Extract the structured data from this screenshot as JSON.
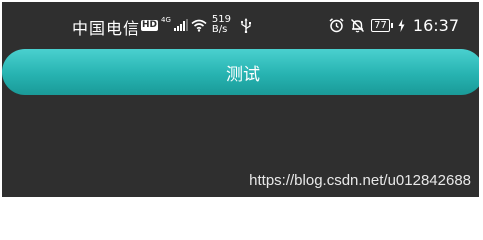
{
  "status_bar": {
    "carrier": "中国电信",
    "hd_badge": "HD",
    "network_type": "4G",
    "speed_value": "519",
    "speed_unit": "B/s",
    "battery": "77",
    "time": "16:37",
    "icons": [
      "hd-icon",
      "signal-icon",
      "wifi-icon",
      "usb-icon",
      "alarm-icon",
      "mute-bell-icon",
      "battery-icon",
      "charging-icon"
    ]
  },
  "main": {
    "button_label": "测试",
    "button_color": "#27b3b1"
  },
  "watermark": {
    "text": "https://blog.csdn.net/u012842688"
  }
}
